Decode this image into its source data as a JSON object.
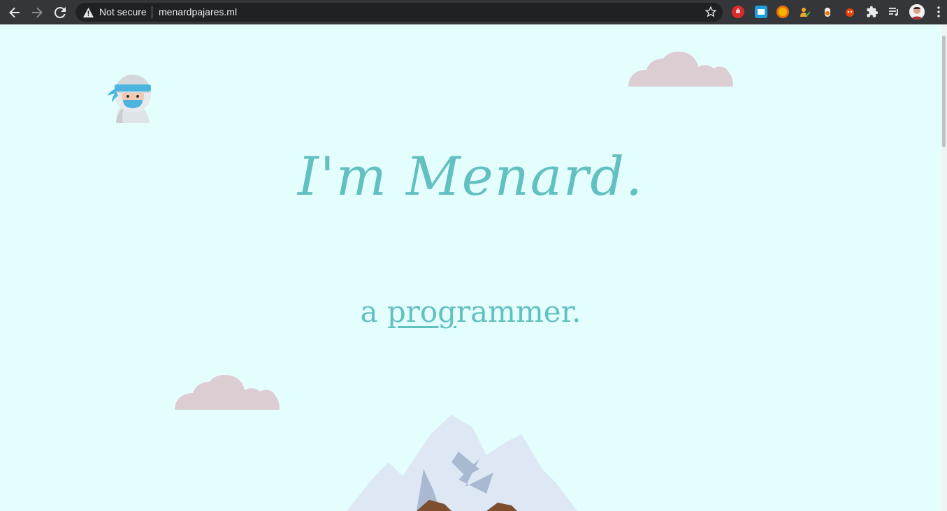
{
  "browser": {
    "security_label": "Not secure",
    "url": "menardpajares.ml"
  },
  "icons": {
    "back": "back-arrow-icon",
    "forward": "forward-arrow-icon",
    "reload": "reload-icon",
    "warning": "warning-icon",
    "bookmark": "star-icon",
    "extensions": [
      "ublock-icon",
      "extension-icon",
      "extension-icon",
      "extension-icon",
      "extension-icon",
      "extension-icon",
      "puzzle-icon",
      "reading-list-icon",
      "profile-avatar",
      "menu-icon"
    ]
  },
  "page": {
    "heading": "I'm Menard.",
    "tagline_prefix": "a ",
    "tagline_underlined": "prog",
    "tagline_rest": "rammer."
  },
  "colors": {
    "background": "#e3fefd",
    "accent": "#63c0c0",
    "cloud": "#dccdd2"
  }
}
